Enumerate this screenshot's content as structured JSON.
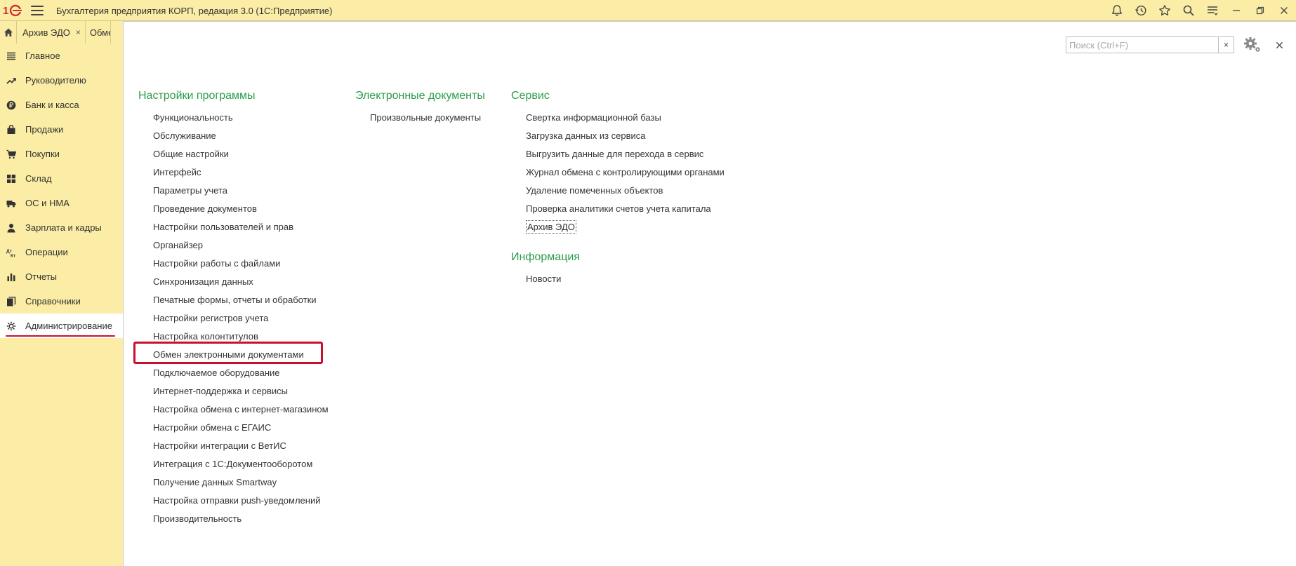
{
  "app": {
    "title": "Бухгалтерия предприятия КОРП, редакция 3.0  (1С:Предприятие)",
    "logo_text": "1С"
  },
  "toolbar": {
    "icons": [
      "bell-icon",
      "history-icon",
      "star-icon",
      "search-icon",
      "settings-list-icon"
    ],
    "window_controls": [
      "minimize-icon",
      "restore-icon",
      "close-icon"
    ]
  },
  "tabs": [
    {
      "label": "Архив ЭДО",
      "close": "×"
    },
    {
      "label": "Обме"
    }
  ],
  "sidebar": {
    "items": [
      {
        "label": "Главное",
        "icon": "menu-lines-icon"
      },
      {
        "label": "Руководителю",
        "icon": "trend-icon"
      },
      {
        "label": "Банк и касса",
        "icon": "ruble-icon"
      },
      {
        "label": "Продажи",
        "icon": "bag-icon"
      },
      {
        "label": "Покупки",
        "icon": "cart-icon"
      },
      {
        "label": "Склад",
        "icon": "grid-icon"
      },
      {
        "label": "ОС и НМА",
        "icon": "truck-icon"
      },
      {
        "label": "Зарплата и кадры",
        "icon": "person-icon"
      },
      {
        "label": "Операции",
        "icon": "dt-kt-icon"
      },
      {
        "label": "Отчеты",
        "icon": "bar-chart-icon"
      },
      {
        "label": "Справочники",
        "icon": "books-icon"
      },
      {
        "label": "Администрирование",
        "icon": "gear-icon",
        "active": true
      }
    ]
  },
  "search": {
    "placeholder": "Поиск (Ctrl+F)",
    "value": "",
    "clear": "×"
  },
  "columns": [
    {
      "heading": "Настройки программы",
      "links": [
        "Функциональность",
        "Обслуживание",
        "Общие настройки",
        "Интерфейс",
        "Параметры учета",
        "Проведение документов",
        "Настройки пользователей и прав",
        "Органайзер",
        "Настройки работы с файлами",
        "Синхронизация данных",
        "Печатные формы, отчеты и обработки",
        "Настройки регистров учета",
        "Настройка колонтитулов",
        "Обмен электронными документами",
        "Подключаемое оборудование",
        "Интернет-поддержка и сервисы",
        "Настройка обмена с интернет-магазином",
        "Настройки обмена с ЕГАИС",
        "Настройки интеграции с ВетИС",
        "Интеграция с 1С:Документооборотом",
        "Получение данных Smartway",
        "Настройка отправки push-уведомлений",
        "Производительность"
      ]
    },
    {
      "heading": "Электронные документы",
      "links": [
        "Произвольные документы"
      ]
    },
    {
      "heading": "Сервис",
      "links": [
        "Свертка информационной базы",
        "Загрузка данных из сервиса",
        "Выгрузить данные для перехода в сервис",
        "Журнал обмена с контролирующими органами",
        "Удаление помеченных объектов",
        "Проверка аналитики счетов учета капитала",
        "Архив ЭДО"
      ],
      "heading2": "Информация",
      "links2": [
        "Новости"
      ]
    }
  ],
  "colors": {
    "sidebar_bg": "#fbeda5",
    "heading_green": "#2c9c4a",
    "highlight_red": "#c8102e"
  }
}
